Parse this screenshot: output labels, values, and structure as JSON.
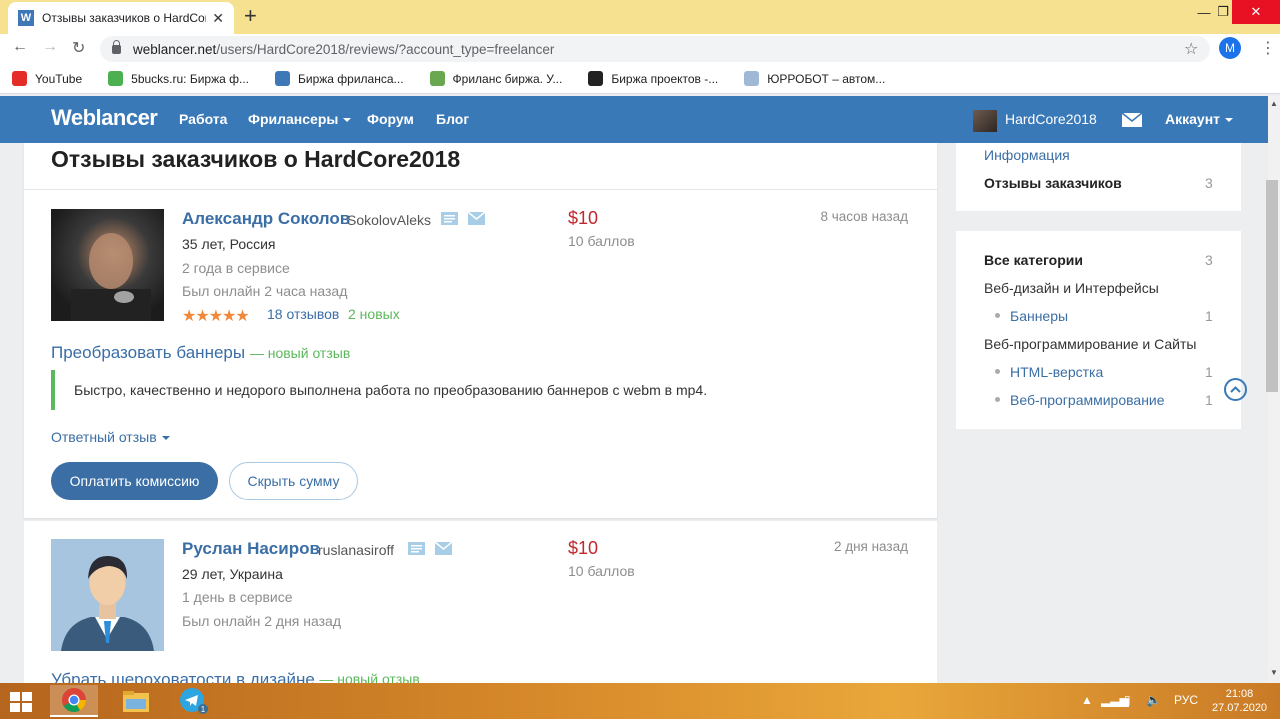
{
  "browser": {
    "tab_title": "Отзывы заказчиков о HardCore2018",
    "tab_favicon": "W",
    "url_host": "weblancer.net",
    "url_path": "/users/HardCore2018/reviews/?account_type=freelancer",
    "profile_initial": "M"
  },
  "bookmarks": [
    {
      "label": "YouTube",
      "color": "#e52d27",
      "icon": "youtube-icon"
    },
    {
      "label": "5bucks.ru: Биржа ф...",
      "color": "#4caf50",
      "icon": "5bucks-icon"
    },
    {
      "label": "Биржа фриланса...",
      "color": "#3f78b7",
      "icon": "weblancer-icon"
    },
    {
      "label": "Фриланс биржа. У...",
      "color": "#6aa84f",
      "icon": "fl-icon"
    },
    {
      "label": "Биржа проектов -...",
      "color": "#222222",
      "icon": "kwork-icon"
    },
    {
      "label": "ЮРРОБОТ – автом...",
      "color": "#9fb8d6",
      "icon": "globe-icon"
    }
  ],
  "site_nav": {
    "logo": "Weblancer",
    "links": [
      "Работа",
      "Фрилансеры",
      "Форум",
      "Блог"
    ],
    "username": "HardCore2018",
    "account": "Аккаунт"
  },
  "page": {
    "title": "Отзывы заказчиков о HardCore2018"
  },
  "reviews": [
    {
      "name": "Александр Соколов",
      "login": "SokolovAleks",
      "age_country": "35 лет, Россия",
      "service": "2 года в сервисе",
      "online": "Был онлайн 2 часа назад",
      "stars": "★★★★★",
      "reviews_count": "18 отзывов",
      "new_count": "2 новых",
      "price": "$10",
      "points": "10 баллов",
      "time": "8 часов назад",
      "project": "Преобразовать баннеры",
      "project_badge": "— новый отзыв",
      "text": "Быстро, качественно и недорого выполнена работа по преобразованию баннеров с webm в mp4.",
      "reply_toggle": "Ответный отзыв",
      "btn_pay": "Оплатить комиссию",
      "btn_hide": "Скрыть сумму"
    },
    {
      "name": "Руслан Насиров",
      "login": "ruslanasiroff",
      "age_country": "29 лет, Украина",
      "service": "1 день в сервисе",
      "online": "Был онлайн 2 дня назад",
      "price": "$10",
      "points": "10 баллов",
      "time": "2 дня назад",
      "project": "Убрать шероховатости в дизайне",
      "project_badge": "— новый отзыв"
    }
  ],
  "sidebar": {
    "info": "Информация",
    "reviews_label": "Отзывы заказчиков",
    "reviews_count": "3",
    "all_categories": "Все категории",
    "all_count": "3",
    "cat1": "Веб-дизайн и Интерфейсы",
    "cat1_sub": "Баннеры",
    "cat1_sub_count": "1",
    "cat2": "Веб-программирование и Сайты",
    "cat2_sub1": "HTML-верстка",
    "cat2_sub1_count": "1",
    "cat2_sub2": "Веб-программирование",
    "cat2_sub2_count": "1"
  },
  "taskbar": {
    "lang": "РУС",
    "time": "21:08",
    "date": "27.07.2020",
    "telegram_badge": "1"
  },
  "colors": {
    "nav_blue": "#3a79b8",
    "link_blue": "#3a6ea5",
    "price_red": "#c1272d",
    "new_green": "#5cb85c",
    "star_orange": "#f0893b"
  }
}
